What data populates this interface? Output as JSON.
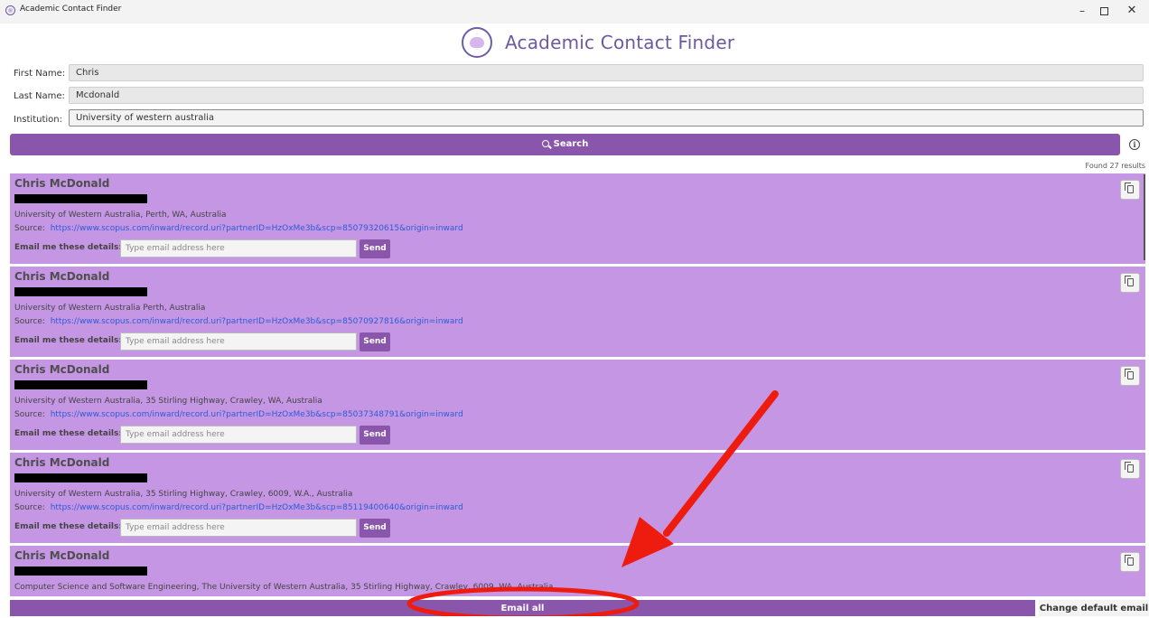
{
  "window": {
    "title": "Academic Contact Finder",
    "minimize": "–",
    "close": "✕"
  },
  "header": {
    "title": "Academic Contact Finder"
  },
  "form": {
    "first_name_label": "First Name:",
    "first_name_value": "Chris",
    "last_name_label": "Last Name:",
    "last_name_value": "Mcdonald",
    "institution_label": "Institution:",
    "institution_value": "University of western australia"
  },
  "search": {
    "label": "Search",
    "info": "i"
  },
  "results_count": "Found 27 results",
  "results": [
    {
      "name": "Chris McDonald",
      "affiliation": "University of Western Australia, Perth, WA, Australia",
      "source_label": "Source:",
      "source_url": "https://www.scopus.com/inward/record.uri?partnerID=HzOxMe3b&scp=85079320615&origin=inward",
      "email_label": "Email me these details:",
      "email_placeholder": "Type email address here",
      "send_label": "Send"
    },
    {
      "name": "Chris McDonald",
      "affiliation": "University of Western Australia Perth, Australia",
      "source_label": "Source:",
      "source_url": "https://www.scopus.com/inward/record.uri?partnerID=HzOxMe3b&scp=85070927816&origin=inward",
      "email_label": "Email me these details:",
      "email_placeholder": "Type email address here",
      "send_label": "Send"
    },
    {
      "name": "Chris McDonald",
      "affiliation": "University of Western Australia, 35 Stirling Highway, Crawley, WA, Australia",
      "source_label": "Source:",
      "source_url": "https://www.scopus.com/inward/record.uri?partnerID=HzOxMe3b&scp=85037348791&origin=inward",
      "email_label": "Email me these details:",
      "email_placeholder": "Type email address here",
      "send_label": "Send"
    },
    {
      "name": "Chris McDonald",
      "affiliation": "University of Western Australia, 35 Stirling Highway, Crawley, 6009, W.A., Australia",
      "source_label": "Source:",
      "source_url": "https://www.scopus.com/inward/record.uri?partnerID=HzOxMe3b&scp=85119400640&origin=inward",
      "email_label": "Email me these details:",
      "email_placeholder": "Type email address here",
      "send_label": "Send"
    },
    {
      "name": "Chris McDonald",
      "affiliation": "Computer Science and Software Engineering, The University of Western Australia, 35 Stirling Highway, Crawley, 6009, WA, Australia"
    }
  ],
  "footer": {
    "email_all_label": "Email all",
    "change_email_label": "Change default email"
  },
  "colors": {
    "accent": "#8a56ac",
    "card_background": "#c596e3",
    "link": "#2c5bd8",
    "annotation": "#ee1c0e"
  }
}
